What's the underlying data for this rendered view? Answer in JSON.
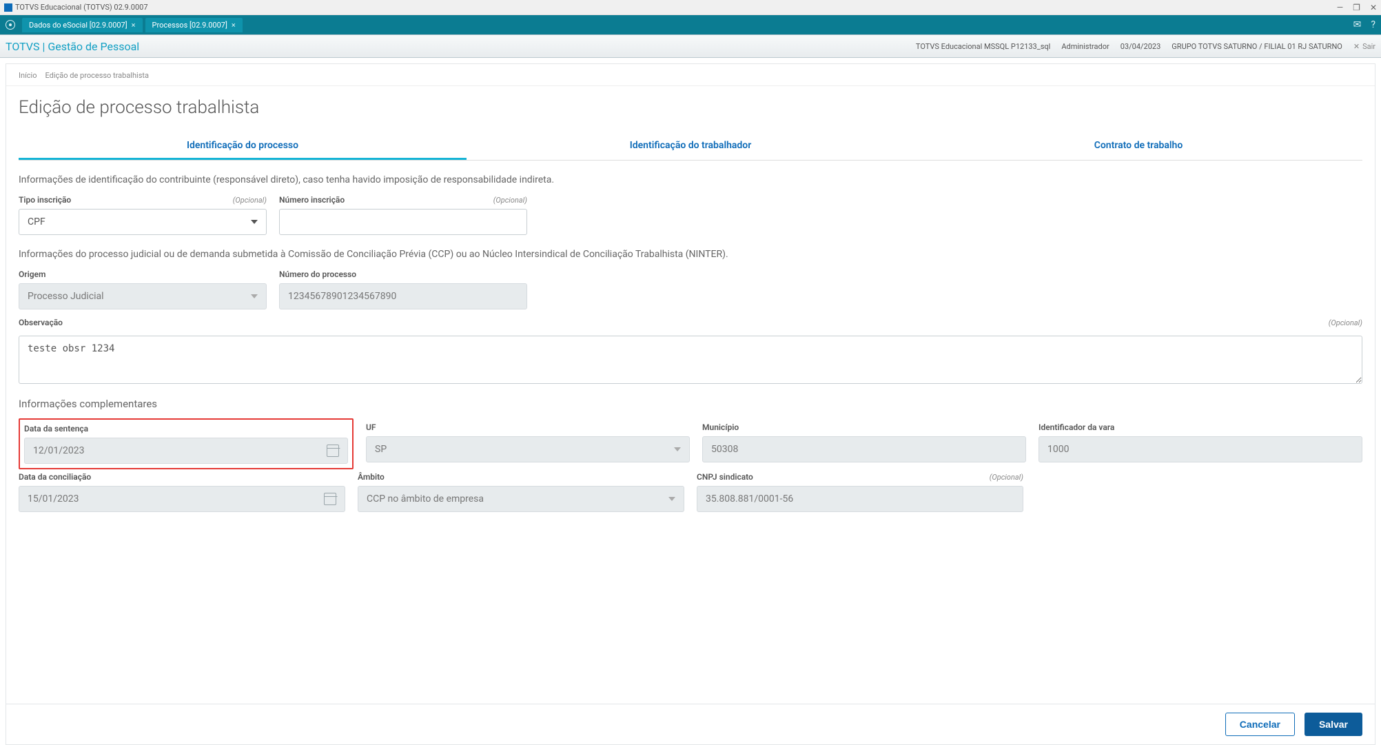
{
  "window": {
    "title": "TOTVS Educacional (TOTVS) 02.9.0007",
    "min": "—",
    "restore": "❐",
    "close": "✕"
  },
  "ribbon": {
    "tabs": [
      {
        "label": "Dados do eSocial [02.9.0007]"
      },
      {
        "label": "Processos [02.9.0007]"
      }
    ]
  },
  "header": {
    "title": "TOTVS | Gestão de Pessoal",
    "env": "TOTVS Educacional MSSQL P12133_sql",
    "user": "Administrador",
    "date": "03/04/2023",
    "company": "GRUPO TOTVS SATURNO / FILIAL 01 RJ SATURNO",
    "logout": "Sair"
  },
  "breadcrumb": {
    "home": "Início",
    "current": "Edição de processo trabalhista"
  },
  "page": {
    "title": "Edição de processo trabalhista",
    "tabs": {
      "ident_proc": "Identificação do processo",
      "ident_trab": "Identificação do trabalhador",
      "contrato": "Contrato de trabalho"
    },
    "info_contribuinte": "Informações de identificação do contribuinte (responsável direto), caso tenha havido imposição de responsabilidade indireta.",
    "info_processo": "Informações do processo judicial ou de demanda submetida à Comissão de Conciliação Prévia (CCP) ou ao Núcleo Intersindical de Conciliação Trabalhista (NINTER).",
    "info_compl_title": "Informações complementares",
    "labels": {
      "tipo_inscricao": "Tipo inscrição",
      "numero_inscricao": "Número inscrição",
      "origem": "Origem",
      "numero_processo": "Número do processo",
      "observacao": "Observação",
      "data_sentenca": "Data da sentença",
      "uf": "UF",
      "municipio": "Município",
      "id_vara": "Identificador da vara",
      "data_conciliacao": "Data da conciliação",
      "ambito": "Âmbito",
      "cnpj_sindicato": "CNPJ sindicato",
      "opcional": "(Opcional)"
    },
    "values": {
      "tipo_inscricao": "CPF",
      "numero_inscricao": "",
      "origem": "Processo Judicial",
      "numero_processo": "12345678901234567890",
      "observacao": "teste obsr 1234",
      "data_sentenca": "12/01/2023",
      "uf": "SP",
      "municipio": "50308",
      "id_vara": "1000",
      "data_conciliacao": "15/01/2023",
      "ambito": "CCP no âmbito de empresa",
      "cnpj_sindicato": "35.808.881/0001-56"
    }
  },
  "footer": {
    "cancel": "Cancelar",
    "save": "Salvar"
  }
}
